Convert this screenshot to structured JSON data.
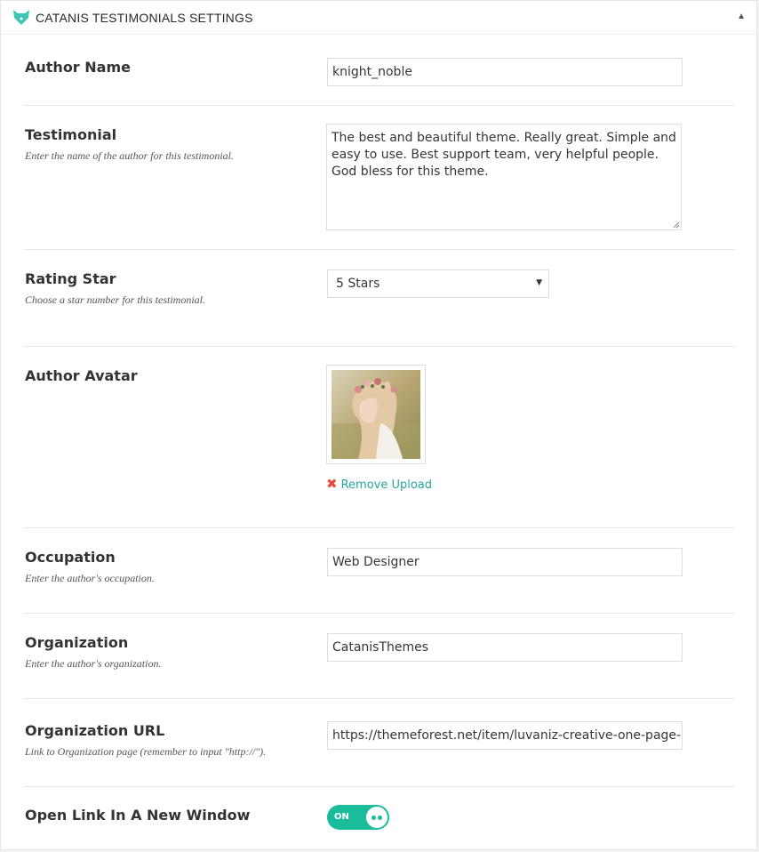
{
  "header": {
    "title": "CATANIS TESTIMONIALS SETTINGS",
    "logo_icon": "catanis-fox-icon",
    "toggle_icon": "collapse-arrow-icon",
    "toggle_glyph": "▲",
    "accent_color": "#1abc9c"
  },
  "fields": {
    "author_name": {
      "label": "Author Name",
      "value": "knight_noble"
    },
    "testimonial": {
      "label": "Testimonial",
      "description": "Enter the name of the author for this testimonial.",
      "value": "The best and beautiful theme. Really great. Simple and easy to use. Best support team, very helpful people. God bless for this theme."
    },
    "rating": {
      "label": "Rating Star",
      "description": "Choose a star number for this testimonial.",
      "selected": "5 Stars",
      "arrow": "▼"
    },
    "avatar": {
      "label": "Author Avatar",
      "remove_label": "Remove Upload",
      "remove_glyph": "✖"
    },
    "occupation": {
      "label": "Occupation",
      "description": "Enter the author's occupation.",
      "value": "Web Designer"
    },
    "organization": {
      "label": "Organization",
      "description": "Enter the author's organization.",
      "value": "CatanisThemes"
    },
    "organization_url": {
      "label": "Organization URL",
      "description": "Link to Organization page (remember to input \"http://\").",
      "value": "https://themeforest.net/item/luvaniz-creative-one-page-wor"
    },
    "new_window": {
      "label": "Open Link In A New Window",
      "state_label": "ON",
      "enabled": true
    }
  }
}
